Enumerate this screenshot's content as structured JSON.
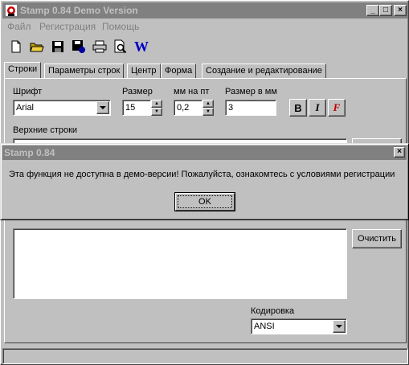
{
  "main_window": {
    "title": "Stamp 0.84 Demo Version",
    "controls": {
      "minimize": "_",
      "maximize": "□",
      "close": "×"
    },
    "menu": [
      "Файл",
      "Регистрация",
      "Помощь"
    ],
    "toolbar": [
      {
        "icon": "new-file-icon"
      },
      {
        "icon": "open-folder-icon"
      },
      {
        "icon": "save-icon"
      },
      {
        "icon": "save-as-icon"
      },
      {
        "icon": "print-icon"
      },
      {
        "icon": "print-preview-icon"
      },
      {
        "icon": "word-icon",
        "label": "W"
      }
    ],
    "tabs": [
      "Строки",
      "Параметры строк",
      "Центр",
      "Форма",
      "Создание и редактирование"
    ],
    "active_tab": "Строки",
    "font": {
      "label": "Шрифт",
      "value": "Arial"
    },
    "size": {
      "label": "Размер",
      "value": "15"
    },
    "mm_per_pt": {
      "label": "мм на пт",
      "value": "0,2"
    },
    "size_mm": {
      "label": "Размер в мм",
      "value": "3"
    },
    "format_buttons": {
      "bold": "B",
      "italic": "I",
      "special": "F"
    },
    "upper_lines_label": "Верхние строки",
    "clear_button": "Очистить",
    "encoding": {
      "label": "Кодировка",
      "value": "ANSI"
    }
  },
  "dialog": {
    "title": "Stamp 0.84",
    "close": "×",
    "message": "Эта функция не доступна в демо-версии! Пожалуйста, ознакомтесь с условиями регистрации",
    "ok": "OK"
  },
  "colors": {
    "face": "#c0c0c0",
    "inactive_title": "#808080",
    "word_icon": "#0000c0"
  }
}
